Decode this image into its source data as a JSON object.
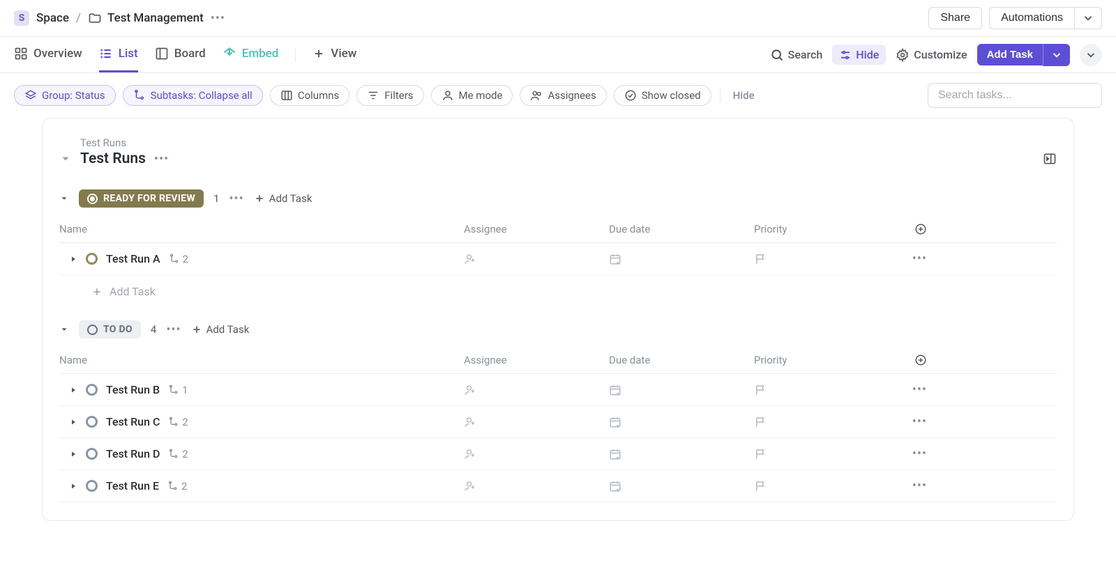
{
  "breadcrumb": {
    "space_badge": "S",
    "space_label": "Space",
    "separator": "/",
    "folder_label": "Test Management",
    "share_label": "Share",
    "automations_label": "Automations"
  },
  "tabs": {
    "overview": "Overview",
    "list": "List",
    "board": "Board",
    "embed": "Embed",
    "view": "View"
  },
  "tab_actions": {
    "search": "Search",
    "hide": "Hide",
    "customize": "Customize",
    "add_task": "Add Task"
  },
  "filters": {
    "group_status": "Group: Status",
    "subtasks": "Subtasks: Collapse all",
    "columns": "Columns",
    "filters": "Filters",
    "me_mode": "Me mode",
    "assignees": "Assignees",
    "show_closed": "Show closed",
    "hide": "Hide",
    "search_placeholder": "Search tasks..."
  },
  "card": {
    "label": "Test Runs",
    "title": "Test Runs"
  },
  "columns": {
    "name": "Name",
    "assignee": "Assignee",
    "due": "Due date",
    "priority": "Priority"
  },
  "groups": [
    {
      "status": "READY FOR REVIEW",
      "style": "ready",
      "count": "1",
      "add_task": "Add Task",
      "tasks": [
        {
          "name": "Test Run A",
          "subtasks": "2"
        }
      ],
      "add_row": "Add Task"
    },
    {
      "status": "TO DO",
      "style": "todo",
      "count": "4",
      "add_task": "Add Task",
      "tasks": [
        {
          "name": "Test Run B",
          "subtasks": "1"
        },
        {
          "name": "Test Run C",
          "subtasks": "2"
        },
        {
          "name": "Test Run D",
          "subtasks": "2"
        },
        {
          "name": "Test Run E",
          "subtasks": "2"
        }
      ]
    }
  ]
}
